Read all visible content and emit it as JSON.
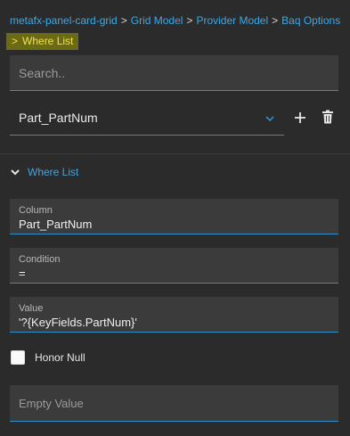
{
  "breadcrumb": {
    "items": [
      "metafx-panel-card-grid",
      "Grid Model",
      "Provider Model",
      "Baq Options"
    ],
    "separator": ">",
    "current": "Where List"
  },
  "search": {
    "placeholder": "Search..",
    "value": ""
  },
  "selector": {
    "selected": "Part_PartNum"
  },
  "icons": {
    "add": "plus-icon",
    "delete": "trash-icon",
    "dropdown": "chevron-down-icon",
    "collapse": "chevron-down-icon"
  },
  "section": {
    "title": "Where List",
    "expanded": true
  },
  "fields": {
    "column": {
      "label": "Column",
      "value": "Part_PartNum"
    },
    "condition": {
      "label": "Condition",
      "value": "="
    },
    "value": {
      "label": "Value",
      "value": "'?{KeyFields.PartNum}'"
    }
  },
  "honor_null": {
    "label": "Honor Null",
    "checked": false
  },
  "empty_value": {
    "placeholder": "Empty Value",
    "value": ""
  },
  "colors": {
    "accent": "#3aa8e8",
    "background": "#2b2b2b",
    "field_bg": "#3b3b3b",
    "highlight_bg": "#6b6b16",
    "highlight_text": "#f5e04a"
  }
}
